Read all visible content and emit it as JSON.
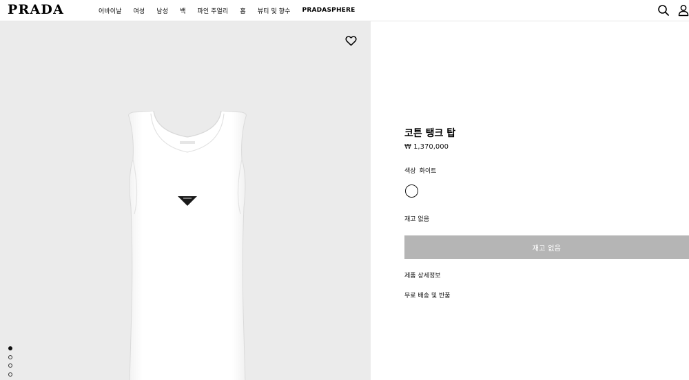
{
  "header": {
    "logo": "PRADA",
    "nav": [
      "어바이날",
      "여성",
      "남성",
      "백",
      "파인 주얼리",
      "홈",
      "뷰티 및 향수",
      "PRADASPHERE"
    ],
    "icons": [
      "search-icon",
      "account-icon"
    ]
  },
  "gallery": {
    "wishlist_icon": "heart-icon",
    "image_count": 4,
    "active_index": 0
  },
  "product": {
    "title": "코튼 탱크 탑",
    "price": "₩ 1,370,000",
    "color_label": "색상",
    "color_value": "화이트",
    "swatch_color": "#ffffff",
    "stock_status": "재고 없음",
    "button_label": "재고 없음",
    "details_link": "제품 상세정보",
    "shipping_link": "무료 배송 및 반품"
  },
  "colors": {
    "button_disabled": "#b5b5b5",
    "image_bg": "#ebebeb"
  }
}
